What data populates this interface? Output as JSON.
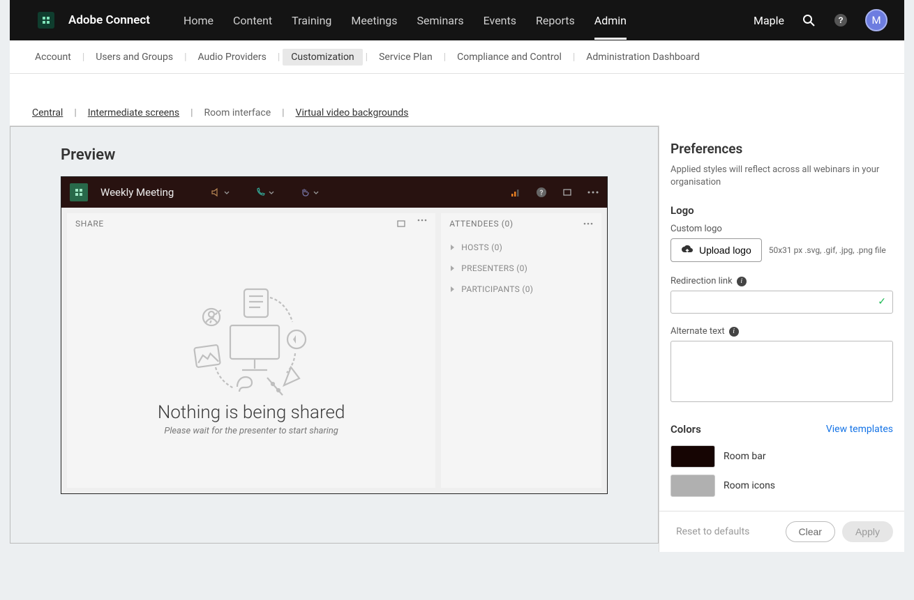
{
  "brand": "Adobe Connect",
  "mainnav": [
    "Home",
    "Content",
    "Training",
    "Meetings",
    "Seminars",
    "Events",
    "Reports",
    "Admin"
  ],
  "mainnav_active": 7,
  "user": {
    "name": "Maple",
    "initial": "M"
  },
  "subnav": [
    "Account",
    "Users and Groups",
    "Audio Providers",
    "Customization",
    "Service Plan",
    "Compliance and Control",
    "Administration Dashboard"
  ],
  "subnav_selected": 3,
  "tertiary": [
    "Central",
    "Intermediate screens",
    "Room interface",
    "Virtual video backgrounds"
  ],
  "tertiary_selected": 2,
  "preview": {
    "title": "Preview",
    "room_title": "Weekly Meeting",
    "share_label": "SHARE",
    "attendees_label": "ATTENDEES (0)",
    "groups": [
      "HOSTS (0)",
      "PRESENTERS (0)",
      "PARTICIPANTS (0)"
    ],
    "empty_title": "Nothing is being shared",
    "empty_sub": "Please wait for the presenter to start sharing"
  },
  "prefs": {
    "title": "Preferences",
    "desc": "Applied styles will reflect across all webinars in your organisation",
    "logo_section": "Logo",
    "custom_logo": "Custom logo",
    "upload_label": "Upload logo",
    "upload_hint": "50x31 px .svg, .gif, .jpg, .png file",
    "redirect_label": "Redirection link",
    "alt_label": "Alternate text",
    "redirect_value": "",
    "alt_value": "",
    "colors_section": "Colors",
    "view_templates": "View templates",
    "colors": [
      {
        "name": "Room bar",
        "hex": "#160503"
      },
      {
        "name": "Room icons",
        "hex": "#b0b0b0"
      }
    ],
    "reset": "Reset to defaults",
    "clear": "Clear",
    "apply": "Apply"
  }
}
